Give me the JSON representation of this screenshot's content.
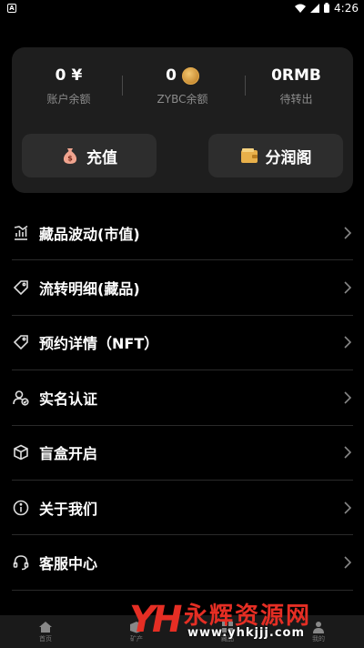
{
  "status_bar": {
    "time": "4:26"
  },
  "balances": [
    {
      "value": "0",
      "unit": "¥",
      "label": "账户余额"
    },
    {
      "value": "0",
      "unit": "",
      "label": "ZYBC余额"
    },
    {
      "value": "0RMB",
      "unit": "",
      "label": "待转出"
    }
  ],
  "buttons": {
    "recharge": "充值",
    "share": "分润阁"
  },
  "menu": [
    {
      "label": "藏品波动(市值)",
      "icon": "chart-icon"
    },
    {
      "label": "流转明细(藏品)",
      "icon": "tag-icon"
    },
    {
      "label": "预约详情（NFT）",
      "icon": "tag-icon"
    },
    {
      "label": "实名认证",
      "icon": "user-verify-icon"
    },
    {
      "label": "盲盒开启",
      "icon": "cube-icon"
    },
    {
      "label": "关于我们",
      "icon": "info-icon"
    },
    {
      "label": "客服中心",
      "icon": "headset-icon"
    }
  ],
  "tabbar": [
    {
      "label": "首页",
      "icon": "home-icon"
    },
    {
      "label": "矿产",
      "icon": "box-icon"
    },
    {
      "label": "藏品",
      "icon": "grid-icon"
    },
    {
      "label": "我的",
      "icon": "user-icon"
    }
  ],
  "watermark": {
    "logo": "YH",
    "title": "永辉资源网",
    "url": "www.yhkjjj.com"
  },
  "colors": {
    "card_bg": "#1e1e1e",
    "button_bg": "#2d2d2d",
    "coin_gold": "#d49a3a",
    "watermark_red": "#e52e24"
  }
}
